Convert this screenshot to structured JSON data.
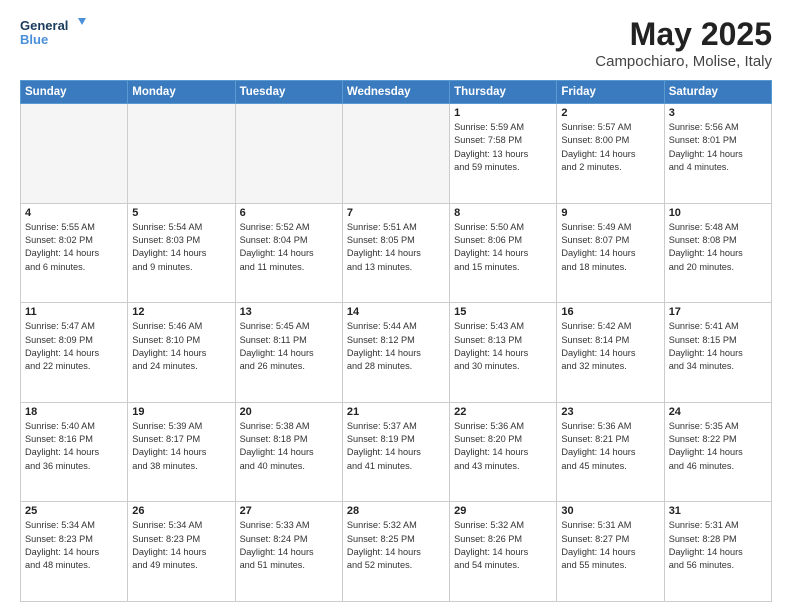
{
  "header": {
    "logo_line1": "General",
    "logo_line2": "Blue",
    "month_title": "May 2025",
    "location": "Campochiaro, Molise, Italy"
  },
  "days_of_week": [
    "Sunday",
    "Monday",
    "Tuesday",
    "Wednesday",
    "Thursday",
    "Friday",
    "Saturday"
  ],
  "weeks": [
    [
      {
        "day": "",
        "info": "",
        "shaded": true
      },
      {
        "day": "",
        "info": "",
        "shaded": true
      },
      {
        "day": "",
        "info": "",
        "shaded": true
      },
      {
        "day": "",
        "info": "",
        "shaded": true
      },
      {
        "day": "1",
        "info": "Sunrise: 5:59 AM\nSunset: 7:58 PM\nDaylight: 13 hours\nand 59 minutes.",
        "shaded": false
      },
      {
        "day": "2",
        "info": "Sunrise: 5:57 AM\nSunset: 8:00 PM\nDaylight: 14 hours\nand 2 minutes.",
        "shaded": false
      },
      {
        "day": "3",
        "info": "Sunrise: 5:56 AM\nSunset: 8:01 PM\nDaylight: 14 hours\nand 4 minutes.",
        "shaded": false
      }
    ],
    [
      {
        "day": "4",
        "info": "Sunrise: 5:55 AM\nSunset: 8:02 PM\nDaylight: 14 hours\nand 6 minutes.",
        "shaded": false
      },
      {
        "day": "5",
        "info": "Sunrise: 5:54 AM\nSunset: 8:03 PM\nDaylight: 14 hours\nand 9 minutes.",
        "shaded": false
      },
      {
        "day": "6",
        "info": "Sunrise: 5:52 AM\nSunset: 8:04 PM\nDaylight: 14 hours\nand 11 minutes.",
        "shaded": false
      },
      {
        "day": "7",
        "info": "Sunrise: 5:51 AM\nSunset: 8:05 PM\nDaylight: 14 hours\nand 13 minutes.",
        "shaded": false
      },
      {
        "day": "8",
        "info": "Sunrise: 5:50 AM\nSunset: 8:06 PM\nDaylight: 14 hours\nand 15 minutes.",
        "shaded": false
      },
      {
        "day": "9",
        "info": "Sunrise: 5:49 AM\nSunset: 8:07 PM\nDaylight: 14 hours\nand 18 minutes.",
        "shaded": false
      },
      {
        "day": "10",
        "info": "Sunrise: 5:48 AM\nSunset: 8:08 PM\nDaylight: 14 hours\nand 20 minutes.",
        "shaded": false
      }
    ],
    [
      {
        "day": "11",
        "info": "Sunrise: 5:47 AM\nSunset: 8:09 PM\nDaylight: 14 hours\nand 22 minutes.",
        "shaded": false
      },
      {
        "day": "12",
        "info": "Sunrise: 5:46 AM\nSunset: 8:10 PM\nDaylight: 14 hours\nand 24 minutes.",
        "shaded": false
      },
      {
        "day": "13",
        "info": "Sunrise: 5:45 AM\nSunset: 8:11 PM\nDaylight: 14 hours\nand 26 minutes.",
        "shaded": false
      },
      {
        "day": "14",
        "info": "Sunrise: 5:44 AM\nSunset: 8:12 PM\nDaylight: 14 hours\nand 28 minutes.",
        "shaded": false
      },
      {
        "day": "15",
        "info": "Sunrise: 5:43 AM\nSunset: 8:13 PM\nDaylight: 14 hours\nand 30 minutes.",
        "shaded": false
      },
      {
        "day": "16",
        "info": "Sunrise: 5:42 AM\nSunset: 8:14 PM\nDaylight: 14 hours\nand 32 minutes.",
        "shaded": false
      },
      {
        "day": "17",
        "info": "Sunrise: 5:41 AM\nSunset: 8:15 PM\nDaylight: 14 hours\nand 34 minutes.",
        "shaded": false
      }
    ],
    [
      {
        "day": "18",
        "info": "Sunrise: 5:40 AM\nSunset: 8:16 PM\nDaylight: 14 hours\nand 36 minutes.",
        "shaded": false
      },
      {
        "day": "19",
        "info": "Sunrise: 5:39 AM\nSunset: 8:17 PM\nDaylight: 14 hours\nand 38 minutes.",
        "shaded": false
      },
      {
        "day": "20",
        "info": "Sunrise: 5:38 AM\nSunset: 8:18 PM\nDaylight: 14 hours\nand 40 minutes.",
        "shaded": false
      },
      {
        "day": "21",
        "info": "Sunrise: 5:37 AM\nSunset: 8:19 PM\nDaylight: 14 hours\nand 41 minutes.",
        "shaded": false
      },
      {
        "day": "22",
        "info": "Sunrise: 5:36 AM\nSunset: 8:20 PM\nDaylight: 14 hours\nand 43 minutes.",
        "shaded": false
      },
      {
        "day": "23",
        "info": "Sunrise: 5:36 AM\nSunset: 8:21 PM\nDaylight: 14 hours\nand 45 minutes.",
        "shaded": false
      },
      {
        "day": "24",
        "info": "Sunrise: 5:35 AM\nSunset: 8:22 PM\nDaylight: 14 hours\nand 46 minutes.",
        "shaded": false
      }
    ],
    [
      {
        "day": "25",
        "info": "Sunrise: 5:34 AM\nSunset: 8:23 PM\nDaylight: 14 hours\nand 48 minutes.",
        "shaded": false
      },
      {
        "day": "26",
        "info": "Sunrise: 5:34 AM\nSunset: 8:23 PM\nDaylight: 14 hours\nand 49 minutes.",
        "shaded": false
      },
      {
        "day": "27",
        "info": "Sunrise: 5:33 AM\nSunset: 8:24 PM\nDaylight: 14 hours\nand 51 minutes.",
        "shaded": false
      },
      {
        "day": "28",
        "info": "Sunrise: 5:32 AM\nSunset: 8:25 PM\nDaylight: 14 hours\nand 52 minutes.",
        "shaded": false
      },
      {
        "day": "29",
        "info": "Sunrise: 5:32 AM\nSunset: 8:26 PM\nDaylight: 14 hours\nand 54 minutes.",
        "shaded": false
      },
      {
        "day": "30",
        "info": "Sunrise: 5:31 AM\nSunset: 8:27 PM\nDaylight: 14 hours\nand 55 minutes.",
        "shaded": false
      },
      {
        "day": "31",
        "info": "Sunrise: 5:31 AM\nSunset: 8:28 PM\nDaylight: 14 hours\nand 56 minutes.",
        "shaded": false
      }
    ]
  ]
}
